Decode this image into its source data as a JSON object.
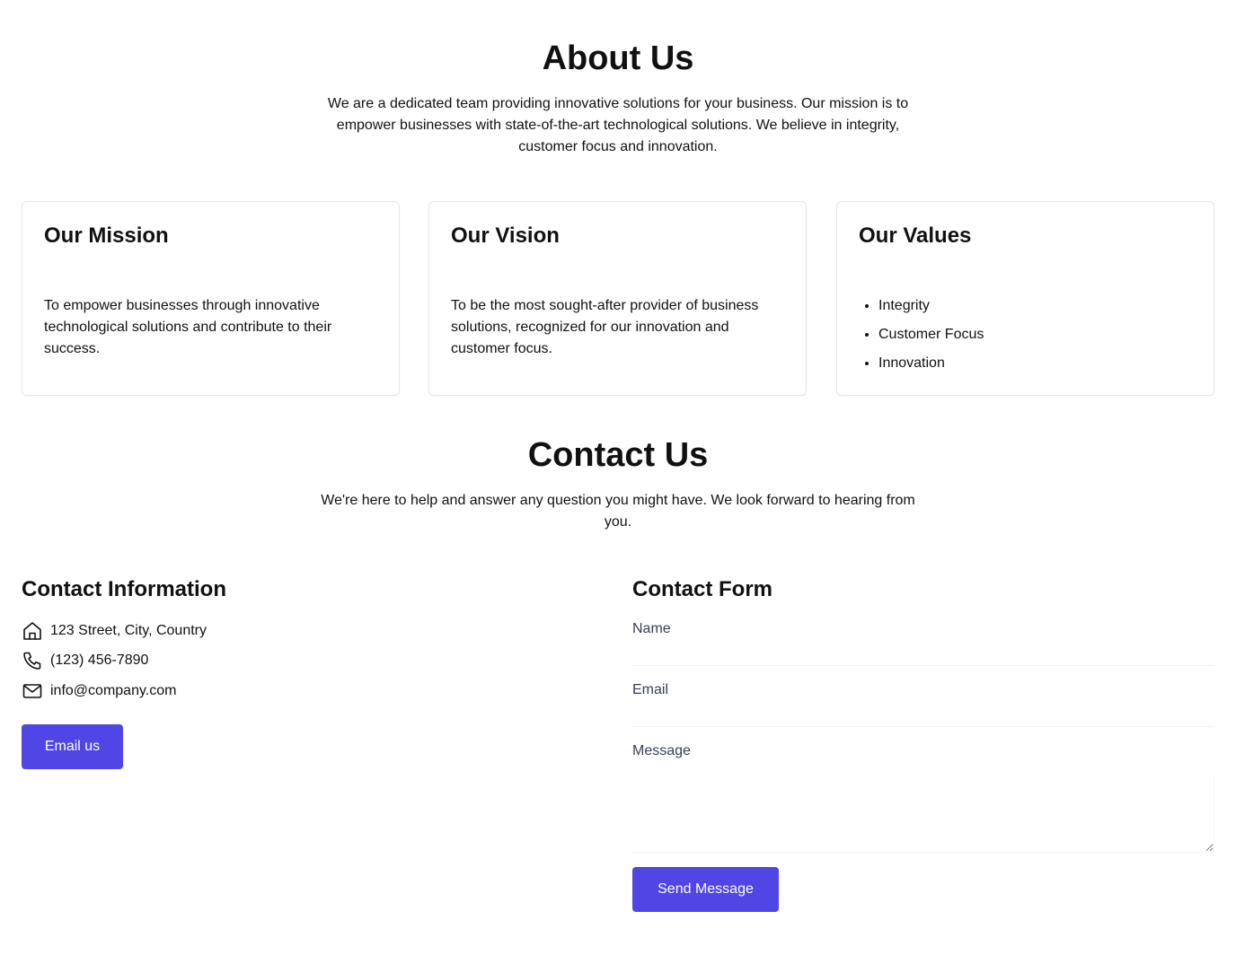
{
  "about": {
    "title": "About Us",
    "intro": "We are a dedicated team providing innovative solutions for your business. Our mission is to empower businesses with state-of-the-art technological solutions. We believe in integrity, customer focus and innovation."
  },
  "cards": {
    "mission": {
      "title": "Our Mission",
      "text": "To empower businesses through innovative technological solutions and contribute to their success."
    },
    "vision": {
      "title": "Our Vision",
      "text": "To be the most sought-after provider of business solutions, recognized for our innovation and customer focus."
    },
    "values": {
      "title": "Our Values",
      "items": [
        "Integrity",
        "Customer Focus",
        "Innovation"
      ]
    }
  },
  "contact": {
    "title": "Contact Us",
    "intro": "We're here to help and answer any question you might have. We look forward to hearing from you.",
    "info": {
      "heading": "Contact Information",
      "address": "123 Street, City, Country",
      "address_icon": "home-icon",
      "phone": "(123) 456-7890",
      "phone_icon": "phone-icon",
      "email": "info@company.com",
      "email_icon": "mail-icon",
      "button_label": "Email us"
    },
    "form": {
      "heading": "Contact Form",
      "name_label": "Name",
      "name_value": "",
      "email_label": "Email",
      "email_value": "",
      "message_label": "Message",
      "message_value": "",
      "submit_label": "Send Message"
    }
  },
  "colors": {
    "accent": "#4f46e5",
    "card_border": "#e5e7eb",
    "text": "#111111",
    "label": "#374151"
  }
}
